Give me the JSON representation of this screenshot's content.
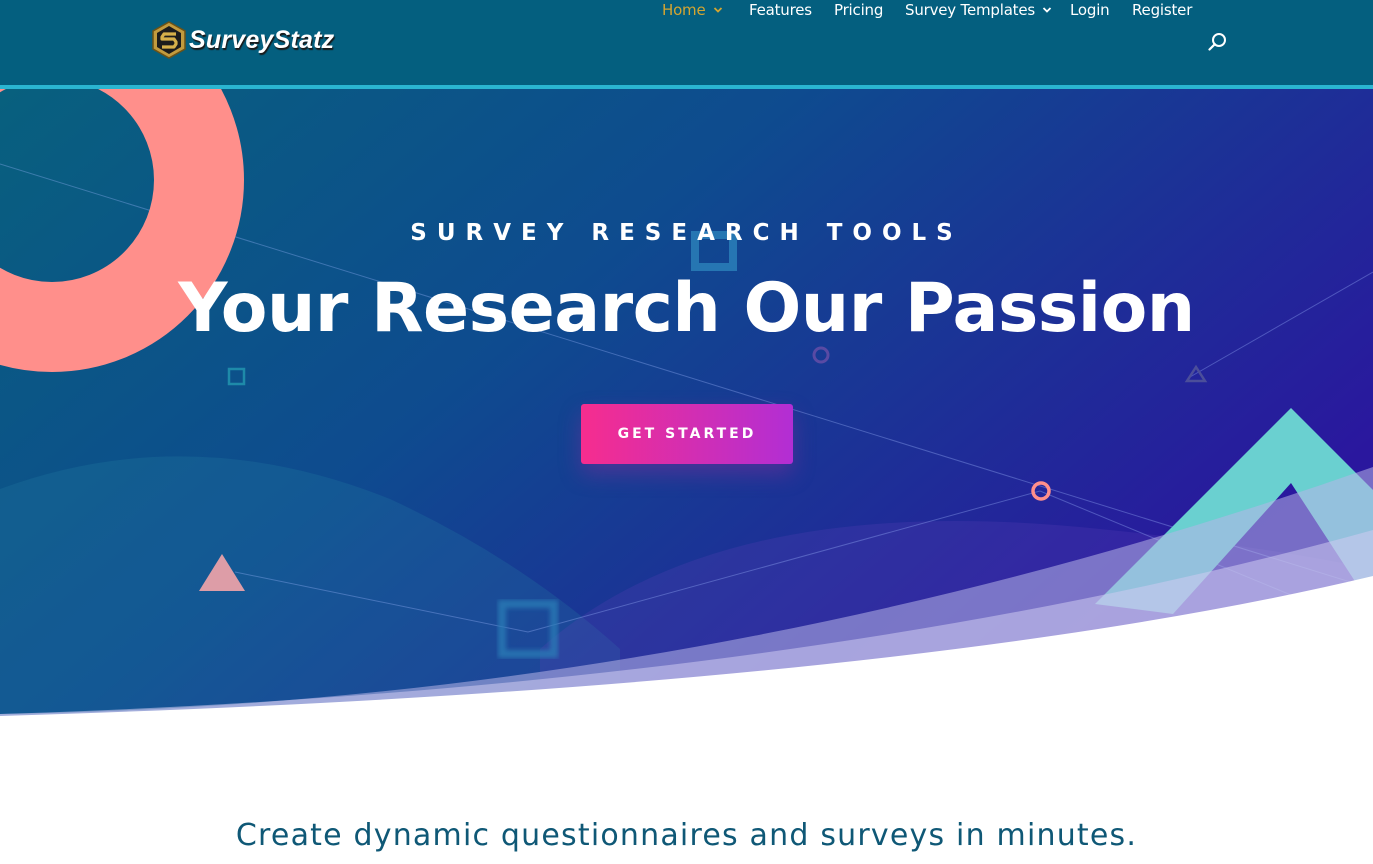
{
  "brand": {
    "name": "SurveyStatz"
  },
  "nav": {
    "items": [
      {
        "label": "Home",
        "active": true,
        "has_dropdown": true
      },
      {
        "label": "Features",
        "active": false,
        "has_dropdown": false
      },
      {
        "label": "Pricing",
        "active": false,
        "has_dropdown": false
      },
      {
        "label": "Survey Templates",
        "active": false,
        "has_dropdown": true
      },
      {
        "label": "Login",
        "active": false,
        "has_dropdown": false
      },
      {
        "label": "Register",
        "active": false,
        "has_dropdown": false
      }
    ],
    "search_icon": "search-icon"
  },
  "hero": {
    "eyebrow": "SURVEY RESEARCH TOOLS",
    "title": "Your Research Our Passion",
    "cta_label": "GET STARTED"
  },
  "section": {
    "tagline": "Create dynamic questionnaires and surveys in minutes."
  },
  "colors": {
    "header_bg": "#045f7f",
    "header_accent_line": "#2ab5d1",
    "nav_active": "#d4a531",
    "hero_gradient_start": "#08607e",
    "hero_gradient_end": "#2a179e",
    "cta_gradient_start": "#f62d8e",
    "cta_gradient_end": "#b22ed4",
    "tagline": "#0f5876",
    "accent_coral": "#ff8f8b",
    "accent_teal": "#6ad0d0"
  }
}
